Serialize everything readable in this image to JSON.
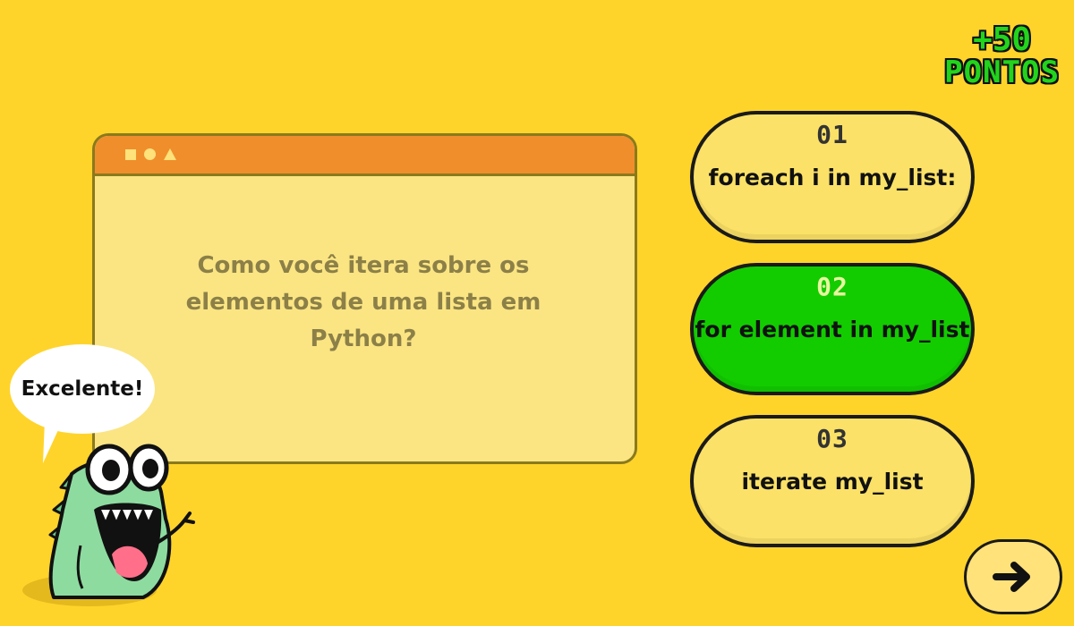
{
  "score": {
    "points": "+50",
    "label": "PONTOS"
  },
  "question": {
    "text": "Como você itera sobre os elementos de uma lista em Python?"
  },
  "answers": [
    {
      "index": "01",
      "text": "foreach i in my_list:",
      "state": "default"
    },
    {
      "index": "02",
      "text": "for element in my_list",
      "state": "correct"
    },
    {
      "index": "03",
      "text": "iterate my_list",
      "state": "default"
    }
  ],
  "mascot": {
    "speech": "Excelente!"
  },
  "colors": {
    "background": "#FFD42A",
    "correct": "#12CC00",
    "answer": "#FBE167",
    "titlebar": "#F08E2C",
    "points": "#22D41B"
  },
  "icons": {
    "next": "arrow-right-icon",
    "window_controls": [
      "square-icon",
      "circle-icon",
      "triangle-icon"
    ]
  }
}
